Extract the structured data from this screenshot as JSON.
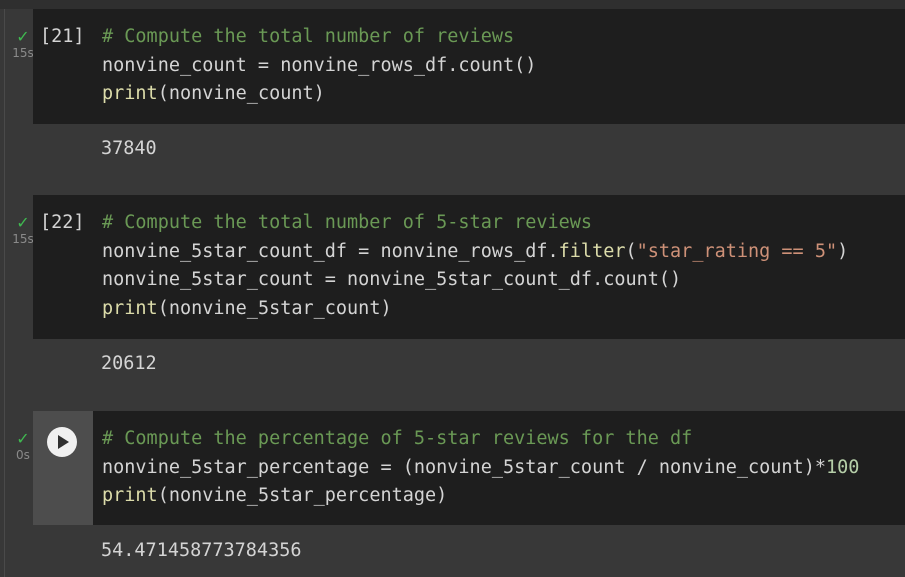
{
  "cells": [
    {
      "status": "✓",
      "time": "15s",
      "exec_count": "[21]",
      "lines": [
        [
          {
            "t": "# Compute the total number of reviews",
            "k": "comment"
          }
        ],
        [
          {
            "t": "nonvine_count = nonvine_rows_df.count()",
            "k": "plain"
          }
        ],
        [
          {
            "t": "print",
            "k": "fn"
          },
          {
            "t": "(nonvine_count)",
            "k": "plain"
          }
        ]
      ],
      "output": "37840"
    },
    {
      "status": "✓",
      "time": "15s",
      "exec_count": "[22]",
      "lines": [
        [
          {
            "t": "# Compute the total number of 5-star reviews",
            "k": "comment"
          }
        ],
        [
          {
            "t": "nonvine_5star_count_df = nonvine_rows_df.",
            "k": "plain"
          },
          {
            "t": "filter",
            "k": "fn"
          },
          {
            "t": "(",
            "k": "plain"
          },
          {
            "t": "\"star_rating == 5\"",
            "k": "str"
          },
          {
            "t": ")",
            "k": "plain"
          }
        ],
        [
          {
            "t": "nonvine_5star_count = nonvine_5star_count_df.count()",
            "k": "plain"
          }
        ],
        [
          {
            "t": "print",
            "k": "fn"
          },
          {
            "t": "(nonvine_5star_count)",
            "k": "plain"
          }
        ]
      ],
      "output": "20612"
    },
    {
      "status": "✓",
      "time": "0s",
      "exec_count": "",
      "lines": [
        [
          {
            "t": "# Compute the percentage of 5-star reviews for the df",
            "k": "comment"
          }
        ],
        [
          {
            "t": "nonvine_5star_percentage = (nonvine_5star_count / nonvine_count)*",
            "k": "plain"
          },
          {
            "t": "100",
            "k": "num"
          }
        ],
        [
          {
            "t": "print",
            "k": "fn"
          },
          {
            "t": "(nonvine_5star_percentage)",
            "k": "plain"
          }
        ]
      ],
      "output": "54.471458773784356"
    }
  ]
}
